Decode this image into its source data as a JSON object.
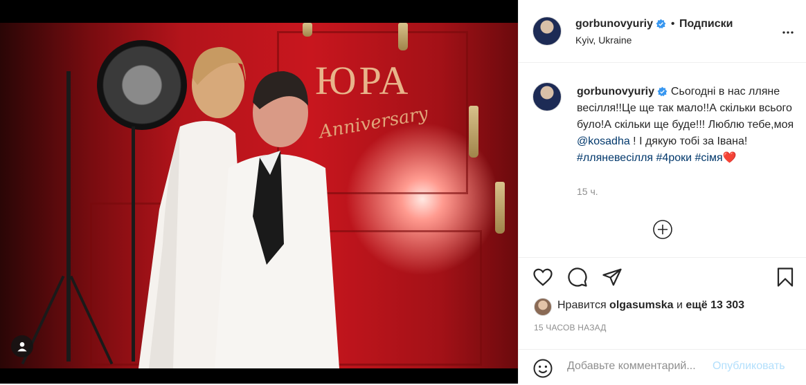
{
  "post": {
    "username": "gorbunovyuriy",
    "follow_label": "Подписки",
    "separator": "•",
    "location": "Kyiv, Ukraine",
    "caption_text": "Сьогодні в нас лляне весілля!!Це ще так мало!!А скільки всього було!А скільки ще буде!!! Люблю тебе,моя ",
    "caption_mention": "@kosadha",
    "caption_text2": " ! І дякую тобі за Івана! ",
    "hashtag1": "#лляневесілля",
    "hashtag2": "#4роки",
    "hashtag3": "#сімя",
    "heart_emoji": "❤️",
    "caption_time": "15 ч.",
    "likes_prefix": "Нравится ",
    "likes_user": "olgasumska",
    "likes_middle": " и ",
    "likes_suffix": "ещё 13 303",
    "time_ago": "15 ЧАСОВ НАЗАД",
    "comment_placeholder": "Добавьте комментарий...",
    "publish_label": "Опубликовать"
  },
  "photo": {
    "sign_title": "ЮРА",
    "sign_script": "Anniversary"
  },
  "icons": {
    "verified": "verified-badge-icon",
    "more": "more-options-icon",
    "like": "heart-icon",
    "comment": "comment-icon",
    "share": "share-icon",
    "save": "bookmark-icon",
    "emoji": "emoji-icon",
    "add": "plus-circle-icon",
    "tagged": "user-tag-icon"
  },
  "colors": {
    "verified": "#3897f0",
    "link": "#00376b",
    "publish": "#b2dffc",
    "muted": "#8e8e8e"
  }
}
